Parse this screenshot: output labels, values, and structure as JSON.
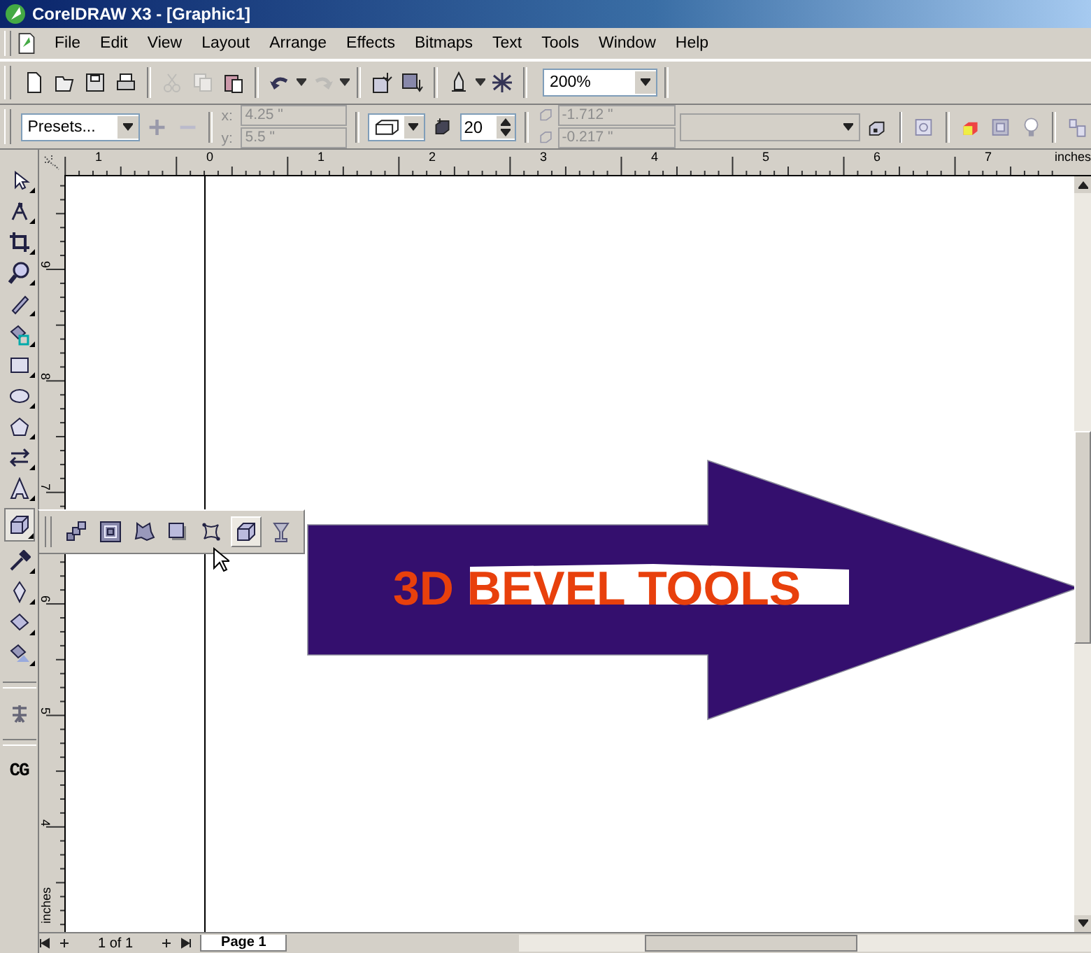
{
  "window": {
    "title": "CorelDRAW X3 - [Graphic1]"
  },
  "menu": [
    "File",
    "Edit",
    "View",
    "Layout",
    "Arrange",
    "Effects",
    "Bitmaps",
    "Text",
    "Tools",
    "Window",
    "Help"
  ],
  "standard_toolbar": {
    "buttons": [
      {
        "disabled": false
      },
      {
        "disabled": false
      },
      {
        "disabled": false
      },
      {
        "disabled": false
      },
      {
        "disabled": true
      },
      {
        "disabled": true
      },
      {
        "disabled": false
      },
      {
        "disabled": false
      },
      {
        "disabled": true
      },
      {
        "disabled": false
      },
      {
        "disabled": false
      },
      {
        "disabled": false
      },
      {
        "disabled": false
      }
    ],
    "zoom": "200%"
  },
  "property_bar": {
    "presets": "Presets...",
    "position": {
      "x_label": "x:",
      "y_label": "y:",
      "x": "4.25 \"",
      "y": "5.5 \"",
      "disabled": true
    },
    "extrude_depth": "20",
    "vanishing_point": {
      "x": "-1.712 \"",
      "y": "-0.217 \"",
      "disabled": true
    }
  },
  "toolbox": [
    {
      "selected": false
    },
    {
      "selected": false
    },
    {
      "selected": false
    },
    {
      "selected": false
    },
    {
      "selected": false
    },
    {
      "selected": false
    },
    {
      "selected": false
    },
    {
      "selected": false
    },
    {
      "selected": false
    },
    {
      "selected": false
    },
    {
      "selected": false
    },
    {
      "selected": true
    },
    {
      "selected": false
    },
    {
      "selected": false
    },
    {
      "selected": false
    },
    {
      "selected": false
    }
  ],
  "toolbox_label": "CG",
  "flyout": [
    {
      "selected": false
    },
    {
      "selected": false
    },
    {
      "selected": false
    },
    {
      "selected": false
    },
    {
      "selected": false
    },
    {
      "selected": true
    },
    {
      "selected": false
    }
  ],
  "rulers": {
    "horizontal": [
      "1",
      "0",
      "1",
      "2",
      "3",
      "4",
      "5",
      "6",
      "7"
    ],
    "horizontal_unit": "inches",
    "vertical": [
      "9",
      "8",
      "7",
      "6",
      "5",
      "4"
    ],
    "vertical_unit": "inches"
  },
  "artwork": {
    "text": "3D BEVEL TOOLS"
  },
  "page_nav": {
    "count": "1 of 1",
    "tabs": [
      {
        "label": "Page 1",
        "selected": true
      }
    ]
  }
}
